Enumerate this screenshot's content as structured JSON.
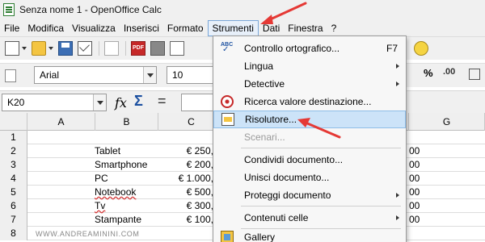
{
  "window": {
    "title": "Senza nome 1 - OpenOffice Calc"
  },
  "menubar": [
    "File",
    "Modifica",
    "Visualizza",
    "Inserisci",
    "Formato",
    "Strumenti",
    "Dati",
    "Finestra",
    "?"
  ],
  "toolbar": {
    "pdf_label": "PDF",
    "font_name": "Arial",
    "font_size": "10"
  },
  "formula_bar": {
    "cell_ref": "K20",
    "fx": "fx",
    "sum": "Σ",
    "equals": "="
  },
  "sheet": {
    "columns": [
      "A",
      "B",
      "C",
      "G"
    ],
    "rows": [
      {
        "n": "1",
        "b": "",
        "c": ""
      },
      {
        "n": "2",
        "b": "Tablet",
        "c": "€ 250,"
      },
      {
        "n": "3",
        "b": "Smartphone",
        "c": "€ 200,"
      },
      {
        "n": "4",
        "b": "PC",
        "c": "€ 1.000,"
      },
      {
        "n": "5",
        "b": "Notebook",
        "c": "€ 500,"
      },
      {
        "n": "6",
        "b": "Tv",
        "c": "€ 300,"
      },
      {
        "n": "7",
        "b": "Stampante",
        "c": "€ 100,"
      },
      {
        "n": "8",
        "b": "",
        "c": ""
      }
    ],
    "right_fragments": [
      "00",
      "00",
      "00",
      "00",
      "00",
      "00"
    ]
  },
  "dropdown": {
    "items": [
      {
        "label": "Controllo ortografico...",
        "accel": "F7"
      },
      {
        "label": "Lingua"
      },
      {
        "label": "Detective"
      },
      {
        "label": "Ricerca valore destinazione..."
      },
      {
        "label": "Risolutore..."
      },
      {
        "label": "Scenari..."
      },
      {
        "label": "Condividi documento..."
      },
      {
        "label": "Unisci documento..."
      },
      {
        "label": "Proteggi documento"
      },
      {
        "label": "Contenuti celle"
      },
      {
        "label": "Gallery"
      }
    ],
    "spell_icon_text": "ABC"
  },
  "watermark": "WWW.ANDREAMININI.COM",
  "colors": {
    "arrow": "#e53935",
    "highlight": "#cce3f8",
    "menu_bg": "#f7f7f7"
  }
}
